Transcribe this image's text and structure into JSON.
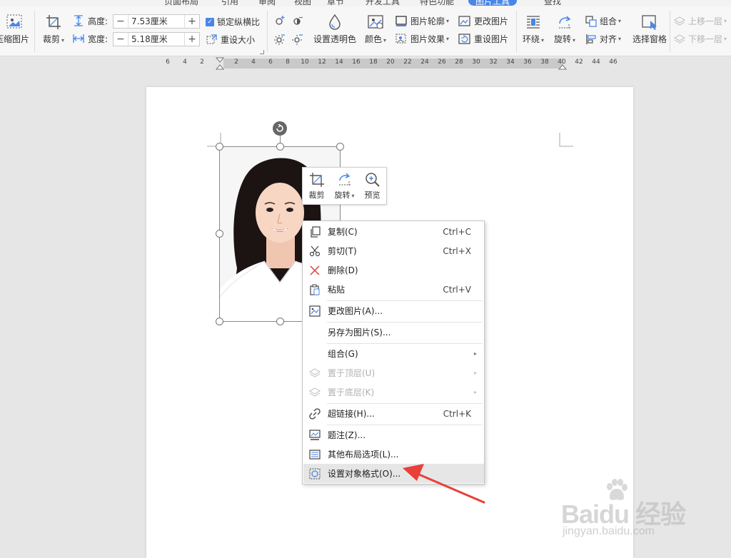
{
  "tabs": [
    "页面布局",
    "引用",
    "审阅",
    "视图",
    "章节",
    "开发工具",
    "特色功能",
    "图片工具",
    "查找"
  ],
  "ribbon": {
    "compress": "压缩图片",
    "crop": "裁剪",
    "height_label": "高度:",
    "height_value": "7.53厘米",
    "width_label": "宽度:",
    "width_value": "5.18厘米",
    "lock_ratio": "锁定纵横比",
    "reset_size": "重设大小",
    "transparency": "设置透明色",
    "color": "颜色",
    "outline": "图片轮廓",
    "effects": "图片效果",
    "change_pic": "更改图片",
    "reset_pic": "重设图片",
    "wrap": "环绕",
    "rotate": "旋转",
    "group": "组合",
    "align": "对齐",
    "select_pane": "选择窗格",
    "bring_forward": "上移一层",
    "send_backward": "下移一层"
  },
  "ruler": [
    "6",
    "4",
    "2",
    "2",
    "4",
    "6",
    "8",
    "10",
    "12",
    "14",
    "16",
    "18",
    "20",
    "22",
    "24",
    "26",
    "28",
    "30",
    "32",
    "34",
    "36",
    "38",
    "40",
    "42",
    "44",
    "46"
  ],
  "mini_toolbar": {
    "crop": "裁剪",
    "rotate": "旋转",
    "preview": "预览"
  },
  "context_menu": {
    "copy": "复制(C)",
    "copy_sc": "Ctrl+C",
    "cut": "剪切(T)",
    "cut_sc": "Ctrl+X",
    "delete": "删除(D)",
    "paste": "粘贴",
    "paste_sc": "Ctrl+V",
    "change_picture": "更改图片(A)...",
    "save_as_picture": "另存为图片(S)...",
    "group": "组合(G)",
    "bring_to_front": "置于顶层(U)",
    "send_to_back": "置于底层(K)",
    "hyperlink": "超链接(H)...",
    "hyperlink_sc": "Ctrl+K",
    "caption": "题注(Z)...",
    "more_layout": "其他布局选项(L)...",
    "format_object": "设置对象格式(O)..."
  },
  "watermark": {
    "brand": "Baidu 经验",
    "url": "jingyan.baidu.com"
  },
  "colors": {
    "accent": "#4a86e8",
    "arrow": "#e8403a",
    "menu_hover": "#e6e6e6"
  }
}
